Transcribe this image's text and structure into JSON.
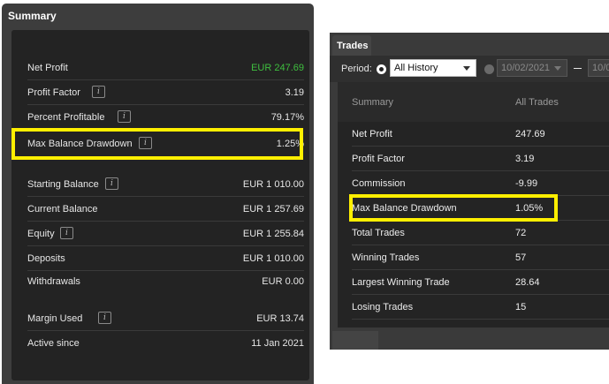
{
  "left": {
    "title": "Summary",
    "rows": [
      {
        "label": "Net Profit",
        "value": "EUR 247.69"
      },
      {
        "label": "Profit Factor",
        "value": "3.19"
      },
      {
        "label": "Percent Profitable",
        "value": "79.17%"
      },
      {
        "label": "Max Balance Drawdown",
        "value": "1.25%"
      },
      {
        "label": "Starting Balance",
        "value": "EUR 1 010.00"
      },
      {
        "label": "Current Balance",
        "value": "EUR 1 257.69"
      },
      {
        "label": "Equity",
        "value": "EUR 1 255.84"
      },
      {
        "label": "Deposits",
        "value": "EUR 1 010.00"
      },
      {
        "label": "Withdrawals",
        "value": "EUR 0.00"
      },
      {
        "label": "Margin Used",
        "value": "EUR 13.74"
      },
      {
        "label": "Active since",
        "value": "11 Jan 2021"
      }
    ],
    "info_glyph": "i"
  },
  "right": {
    "tab": "Trades",
    "period_label": "Period:",
    "history_select": "All History",
    "date_from": "10/02/2021",
    "date_to": "10/0",
    "header": {
      "col1": "Summary",
      "col2": "All Trades"
    },
    "rows": [
      {
        "label": "Net Profit",
        "value": "247.69"
      },
      {
        "label": "Profit Factor",
        "value": "3.19"
      },
      {
        "label": "Commission",
        "value": "-9.99"
      },
      {
        "label": "Max Balance Drawdown",
        "value": "1.05%"
      },
      {
        "label": "Total Trades",
        "value": "72"
      },
      {
        "label": "Winning Trades",
        "value": "57"
      },
      {
        "label": "Largest Winning Trade",
        "value": "28.64"
      },
      {
        "label": "Losing Trades",
        "value": "15"
      }
    ]
  },
  "colors": {
    "highlight": "#ffef00",
    "profit_green": "#3fbf3f",
    "panel_bg": "#3d3d3d",
    "table_bg": "#232323"
  }
}
